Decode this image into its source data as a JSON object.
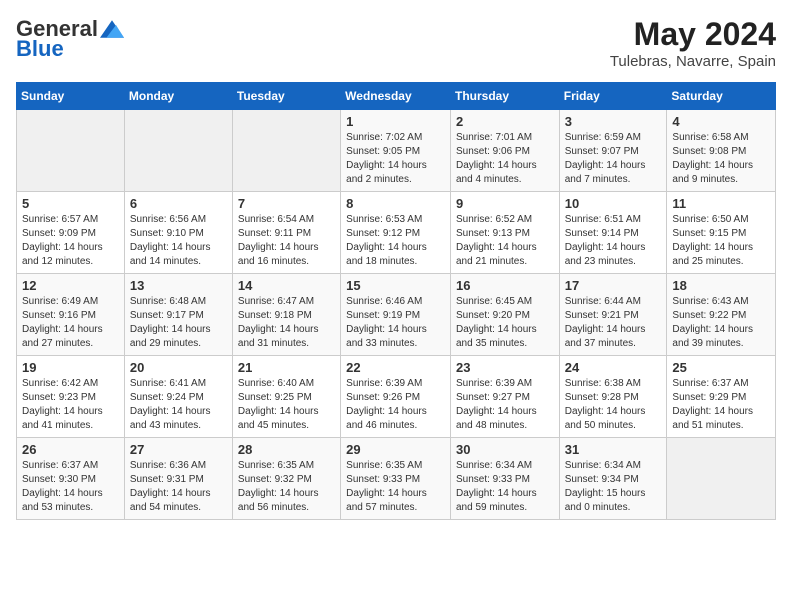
{
  "logo": {
    "general": "General",
    "blue": "Blue"
  },
  "header": {
    "month_year": "May 2024",
    "location": "Tulebras, Navarre, Spain"
  },
  "weekdays": [
    "Sunday",
    "Monday",
    "Tuesday",
    "Wednesday",
    "Thursday",
    "Friday",
    "Saturday"
  ],
  "weeks": [
    [
      {
        "day": "",
        "sunrise": "",
        "sunset": "",
        "daylight": "",
        "empty": true
      },
      {
        "day": "",
        "sunrise": "",
        "sunset": "",
        "daylight": "",
        "empty": true
      },
      {
        "day": "",
        "sunrise": "",
        "sunset": "",
        "daylight": "",
        "empty": true
      },
      {
        "day": "1",
        "sunrise": "Sunrise: 7:02 AM",
        "sunset": "Sunset: 9:05 PM",
        "daylight": "Daylight: 14 hours and 2 minutes."
      },
      {
        "day": "2",
        "sunrise": "Sunrise: 7:01 AM",
        "sunset": "Sunset: 9:06 PM",
        "daylight": "Daylight: 14 hours and 4 minutes."
      },
      {
        "day": "3",
        "sunrise": "Sunrise: 6:59 AM",
        "sunset": "Sunset: 9:07 PM",
        "daylight": "Daylight: 14 hours and 7 minutes."
      },
      {
        "day": "4",
        "sunrise": "Sunrise: 6:58 AM",
        "sunset": "Sunset: 9:08 PM",
        "daylight": "Daylight: 14 hours and 9 minutes."
      }
    ],
    [
      {
        "day": "5",
        "sunrise": "Sunrise: 6:57 AM",
        "sunset": "Sunset: 9:09 PM",
        "daylight": "Daylight: 14 hours and 12 minutes."
      },
      {
        "day": "6",
        "sunrise": "Sunrise: 6:56 AM",
        "sunset": "Sunset: 9:10 PM",
        "daylight": "Daylight: 14 hours and 14 minutes."
      },
      {
        "day": "7",
        "sunrise": "Sunrise: 6:54 AM",
        "sunset": "Sunset: 9:11 PM",
        "daylight": "Daylight: 14 hours and 16 minutes."
      },
      {
        "day": "8",
        "sunrise": "Sunrise: 6:53 AM",
        "sunset": "Sunset: 9:12 PM",
        "daylight": "Daylight: 14 hours and 18 minutes."
      },
      {
        "day": "9",
        "sunrise": "Sunrise: 6:52 AM",
        "sunset": "Sunset: 9:13 PM",
        "daylight": "Daylight: 14 hours and 21 minutes."
      },
      {
        "day": "10",
        "sunrise": "Sunrise: 6:51 AM",
        "sunset": "Sunset: 9:14 PM",
        "daylight": "Daylight: 14 hours and 23 minutes."
      },
      {
        "day": "11",
        "sunrise": "Sunrise: 6:50 AM",
        "sunset": "Sunset: 9:15 PM",
        "daylight": "Daylight: 14 hours and 25 minutes."
      }
    ],
    [
      {
        "day": "12",
        "sunrise": "Sunrise: 6:49 AM",
        "sunset": "Sunset: 9:16 PM",
        "daylight": "Daylight: 14 hours and 27 minutes."
      },
      {
        "day": "13",
        "sunrise": "Sunrise: 6:48 AM",
        "sunset": "Sunset: 9:17 PM",
        "daylight": "Daylight: 14 hours and 29 minutes."
      },
      {
        "day": "14",
        "sunrise": "Sunrise: 6:47 AM",
        "sunset": "Sunset: 9:18 PM",
        "daylight": "Daylight: 14 hours and 31 minutes."
      },
      {
        "day": "15",
        "sunrise": "Sunrise: 6:46 AM",
        "sunset": "Sunset: 9:19 PM",
        "daylight": "Daylight: 14 hours and 33 minutes."
      },
      {
        "day": "16",
        "sunrise": "Sunrise: 6:45 AM",
        "sunset": "Sunset: 9:20 PM",
        "daylight": "Daylight: 14 hours and 35 minutes."
      },
      {
        "day": "17",
        "sunrise": "Sunrise: 6:44 AM",
        "sunset": "Sunset: 9:21 PM",
        "daylight": "Daylight: 14 hours and 37 minutes."
      },
      {
        "day": "18",
        "sunrise": "Sunrise: 6:43 AM",
        "sunset": "Sunset: 9:22 PM",
        "daylight": "Daylight: 14 hours and 39 minutes."
      }
    ],
    [
      {
        "day": "19",
        "sunrise": "Sunrise: 6:42 AM",
        "sunset": "Sunset: 9:23 PM",
        "daylight": "Daylight: 14 hours and 41 minutes."
      },
      {
        "day": "20",
        "sunrise": "Sunrise: 6:41 AM",
        "sunset": "Sunset: 9:24 PM",
        "daylight": "Daylight: 14 hours and 43 minutes."
      },
      {
        "day": "21",
        "sunrise": "Sunrise: 6:40 AM",
        "sunset": "Sunset: 9:25 PM",
        "daylight": "Daylight: 14 hours and 45 minutes."
      },
      {
        "day": "22",
        "sunrise": "Sunrise: 6:39 AM",
        "sunset": "Sunset: 9:26 PM",
        "daylight": "Daylight: 14 hours and 46 minutes."
      },
      {
        "day": "23",
        "sunrise": "Sunrise: 6:39 AM",
        "sunset": "Sunset: 9:27 PM",
        "daylight": "Daylight: 14 hours and 48 minutes."
      },
      {
        "day": "24",
        "sunrise": "Sunrise: 6:38 AM",
        "sunset": "Sunset: 9:28 PM",
        "daylight": "Daylight: 14 hours and 50 minutes."
      },
      {
        "day": "25",
        "sunrise": "Sunrise: 6:37 AM",
        "sunset": "Sunset: 9:29 PM",
        "daylight": "Daylight: 14 hours and 51 minutes."
      }
    ],
    [
      {
        "day": "26",
        "sunrise": "Sunrise: 6:37 AM",
        "sunset": "Sunset: 9:30 PM",
        "daylight": "Daylight: 14 hours and 53 minutes."
      },
      {
        "day": "27",
        "sunrise": "Sunrise: 6:36 AM",
        "sunset": "Sunset: 9:31 PM",
        "daylight": "Daylight: 14 hours and 54 minutes."
      },
      {
        "day": "28",
        "sunrise": "Sunrise: 6:35 AM",
        "sunset": "Sunset: 9:32 PM",
        "daylight": "Daylight: 14 hours and 56 minutes."
      },
      {
        "day": "29",
        "sunrise": "Sunrise: 6:35 AM",
        "sunset": "Sunset: 9:33 PM",
        "daylight": "Daylight: 14 hours and 57 minutes."
      },
      {
        "day": "30",
        "sunrise": "Sunrise: 6:34 AM",
        "sunset": "Sunset: 9:33 PM",
        "daylight": "Daylight: 14 hours and 59 minutes."
      },
      {
        "day": "31",
        "sunrise": "Sunrise: 6:34 AM",
        "sunset": "Sunset: 9:34 PM",
        "daylight": "Daylight: 15 hours and 0 minutes."
      },
      {
        "day": "",
        "sunrise": "",
        "sunset": "",
        "daylight": "",
        "empty": true
      }
    ]
  ]
}
